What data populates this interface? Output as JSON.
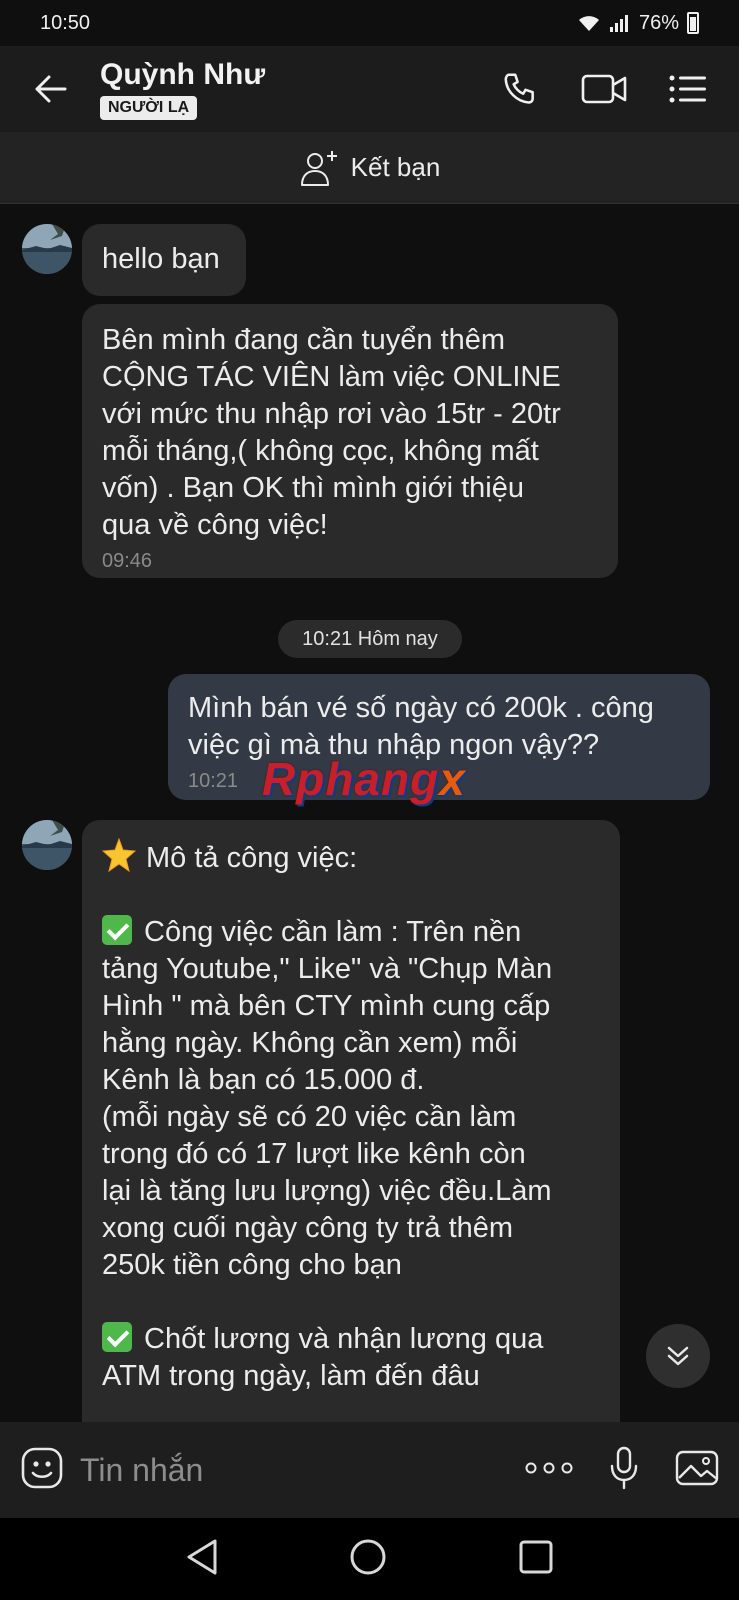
{
  "status": {
    "time": "10:50",
    "battery": "76%"
  },
  "header": {
    "name": "Quỳnh Như",
    "badge": "NGƯỜI LẠ"
  },
  "add_friend": {
    "label": "Kết bạn"
  },
  "messages": {
    "m1": {
      "text": "hello bạn"
    },
    "m2": {
      "lines": [
        "Bên mình đang cần tuyển thêm",
        "CỘNG TÁC VIÊN làm việc ONLINE",
        "với mức thu nhập rơi vào 15tr - 20tr",
        "mỗi tháng,( không  cọc, không mất",
        "vốn)  .  Bạn OK thì mình giới thiệu",
        "qua về công việc!"
      ],
      "time": "09:46"
    },
    "date_divider": "10:21 Hôm nay",
    "m3": {
      "lines": [
        "Mình bán vé số ngày có 200k . công",
        "việc gì mà thu nhập ngon vậy??"
      ],
      "time": "10:21"
    },
    "m4": {
      "title": "Mô tả công việc:",
      "p1": [
        "Công việc cần làm :  Trên nền",
        "tảng  Youtube,\" Like\"  và \"Chụp Màn",
        "Hình \" mà bên CTY mình cung cấp",
        "hằng  ngày. Không cần xem) mỗi",
        "Kênh  là bạn có 15.000 đ.",
        "(mỗi ngày sẽ có  20 việc cần làm",
        "trong đó có 17 lượt  like kênh còn",
        "lại là tăng lưu lượng) việc đều.Làm",
        "xong cuối ngày công ty trả thêm",
        "250k tiền công cho bạn"
      ],
      "p2": [
        "Chốt lương và nhận lương qua",
        "ATM   trong ngày, làm đến đâu"
      ]
    }
  },
  "watermark": {
    "main": "Rphang",
    "tail": "x"
  },
  "composer": {
    "placeholder": "Tin nhắn"
  },
  "colors": {
    "bubble_other": "#2a2a2a",
    "bubble_me": "#333a46",
    "background": "#0f0f0f"
  }
}
